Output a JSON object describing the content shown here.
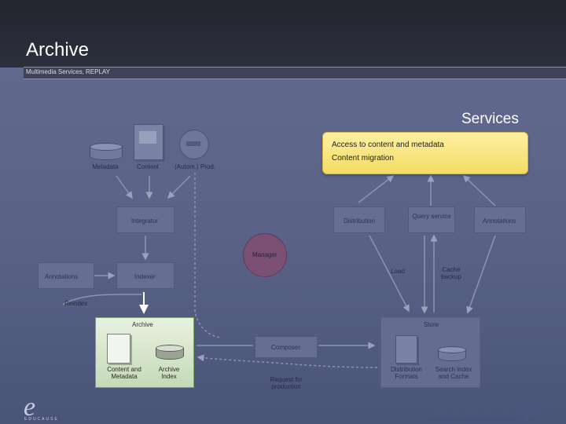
{
  "header": {
    "title": "Archive",
    "subtitle": "Multimedia Services, REPLAY"
  },
  "services": {
    "title": "Services"
  },
  "callout": {
    "line1": "Access to content and metadata",
    "line2": "Content migration"
  },
  "sources": {
    "metadata": "Metadata",
    "content": "Content",
    "production": "(Autom.) Prod."
  },
  "boxes": {
    "integrator": "Integrator",
    "distribution": "Distribution",
    "query_service": "Query service",
    "annotations_right": "Annotations",
    "annotations_left": "Annotations",
    "indexer": "Indexer",
    "manager": "Manager",
    "load": "Load",
    "cache_backup": "Cache backup",
    "reindex": "Reindex",
    "composer": "Composer",
    "request": "Request for production"
  },
  "archive": {
    "title": "Archive",
    "content_metadata": "Content and Metadata",
    "archive_index": "Archive Index"
  },
  "store": {
    "title": "Store",
    "distribution_formats": "Distribution Formats",
    "search_index": "Search index and Cache"
  },
  "footer": {
    "logo_letter": "e",
    "logo_text": "EDUCAUSE",
    "brand": "Informatikdienste"
  },
  "colors": {
    "accent": "#f3dc62",
    "archive_bg": "#c5dab8",
    "manager": "#7c5074"
  }
}
